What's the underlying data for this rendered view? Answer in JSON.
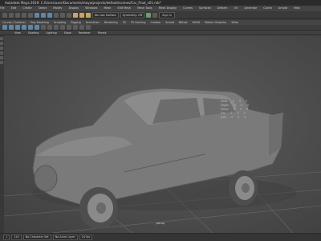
{
  "window": {
    "title": "Autodesk Maya 2019: C:/Users/user/Documents/maya/projects/default/scenes/Car_Final_v01.mb*"
  },
  "menu": {
    "items": [
      "File",
      "Edit",
      "Create",
      "Select",
      "Modify",
      "Display",
      "Windows",
      "Mesh",
      "Edit Mesh",
      "Mesh Tools",
      "Mesh Display",
      "Curves",
      "Surfaces",
      "Deform",
      "UV",
      "Generate",
      "Cache",
      "Arnold",
      "Help"
    ]
  },
  "statusline": {
    "live_surface": "No Live Surface",
    "symmetry": "Symmetry: Off",
    "signin": "Sign In"
  },
  "shelf": {
    "tabs": [
      "Curves / Surfaces",
      "Poly Modeling",
      "Sculpting",
      "Rigging",
      "Animation",
      "Rendering",
      "FX",
      "FX Caching",
      "Custom",
      "Arnold",
      "Bifrost",
      "MASH",
      "Motion Graphics",
      "XGen"
    ]
  },
  "panel": {
    "menus": [
      "View",
      "Shading",
      "Lighting",
      "Show",
      "Renderer",
      "Panels"
    ]
  },
  "hud": {
    "rows": [
      {
        "label": "Verts:",
        "v1": "0",
        "v2": "0",
        "v3": "0"
      },
      {
        "label": "Edges:",
        "v1": "0",
        "v2": "0",
        "v3": "0"
      },
      {
        "label": "Faces:",
        "v1": "0",
        "v2": "0",
        "v3": "0"
      },
      {
        "label": "Tris:",
        "v1": "0",
        "v2": "0",
        "v3": "0"
      },
      {
        "label": "UVs:",
        "v1": "0",
        "v2": "0",
        "v3": "0"
      }
    ]
  },
  "viewport": {
    "camera_label": "persp"
  },
  "bottom": {
    "frame_start": "1",
    "frame_end": "120",
    "char_set": "No Character Set",
    "anim_layer": "No Anim Layer",
    "fps": "24 fps"
  },
  "colors": {
    "body": "#3c3c3c",
    "viewport_center": "#5f5f5f",
    "car": "#7a7a7a"
  }
}
